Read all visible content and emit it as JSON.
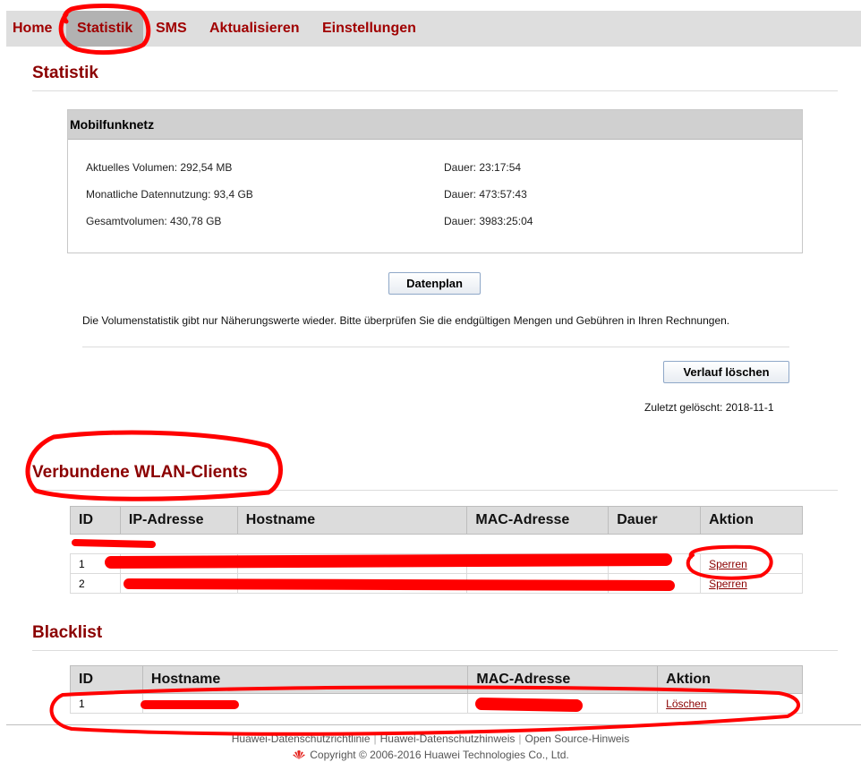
{
  "nav": {
    "home": "Home",
    "statistik": "Statistik",
    "sms": "SMS",
    "aktualisieren": "Aktualisieren",
    "einstellungen": "Einstellungen"
  },
  "statistik": {
    "title": "Statistik",
    "panel_title": "Mobilfunknetz",
    "current_volume": "Aktuelles Volumen: 292,54 MB",
    "current_duration": "Dauer: 23:17:54",
    "monthly_usage": "Monatliche Datennutzung: 93,4 GB",
    "monthly_duration": "Dauer: 473:57:43",
    "total_volume": "Gesamtvolumen: 430,78 GB",
    "total_duration": "Dauer: 3983:25:04",
    "data_plan_button": "Datenplan",
    "disclaimer": "Die Volumenstatistik gibt nur Näherungswerte wieder. Bitte überprüfen Sie die endgültigen Mengen und Gebühren in Ihren Rechnungen.",
    "clear_history_button": "Verlauf löschen",
    "last_cleared": "Zuletzt gelöscht: 2018-11-1"
  },
  "wlan": {
    "title": "Verbundene WLAN-Clients",
    "columns": [
      "ID",
      "IP-Adresse",
      "Hostname",
      "MAC-Adresse",
      "Dauer",
      "Aktion"
    ],
    "rows": [
      {
        "id": "1",
        "action": "Sperren"
      },
      {
        "id": "2",
        "action": "Sperren"
      }
    ]
  },
  "blacklist": {
    "title": "Blacklist",
    "columns": [
      "ID",
      "Hostname",
      "MAC-Adresse",
      "Aktion"
    ],
    "rows": [
      {
        "id": "1",
        "action": "Löschen"
      }
    ]
  },
  "footer": {
    "link_privacy_policy": "Huawei-Datenschutzrichtlinie",
    "link_privacy_notice": "Huawei-Datenschutzhinweis",
    "link_open_source": "Open Source-Hinweis",
    "copyright": "Copyright © 2006-2016 Huawei Technologies Co., Ltd."
  },
  "colors": {
    "accent": "#8b0000",
    "nav_bg": "#dedede",
    "annotation": "#ff0000"
  }
}
